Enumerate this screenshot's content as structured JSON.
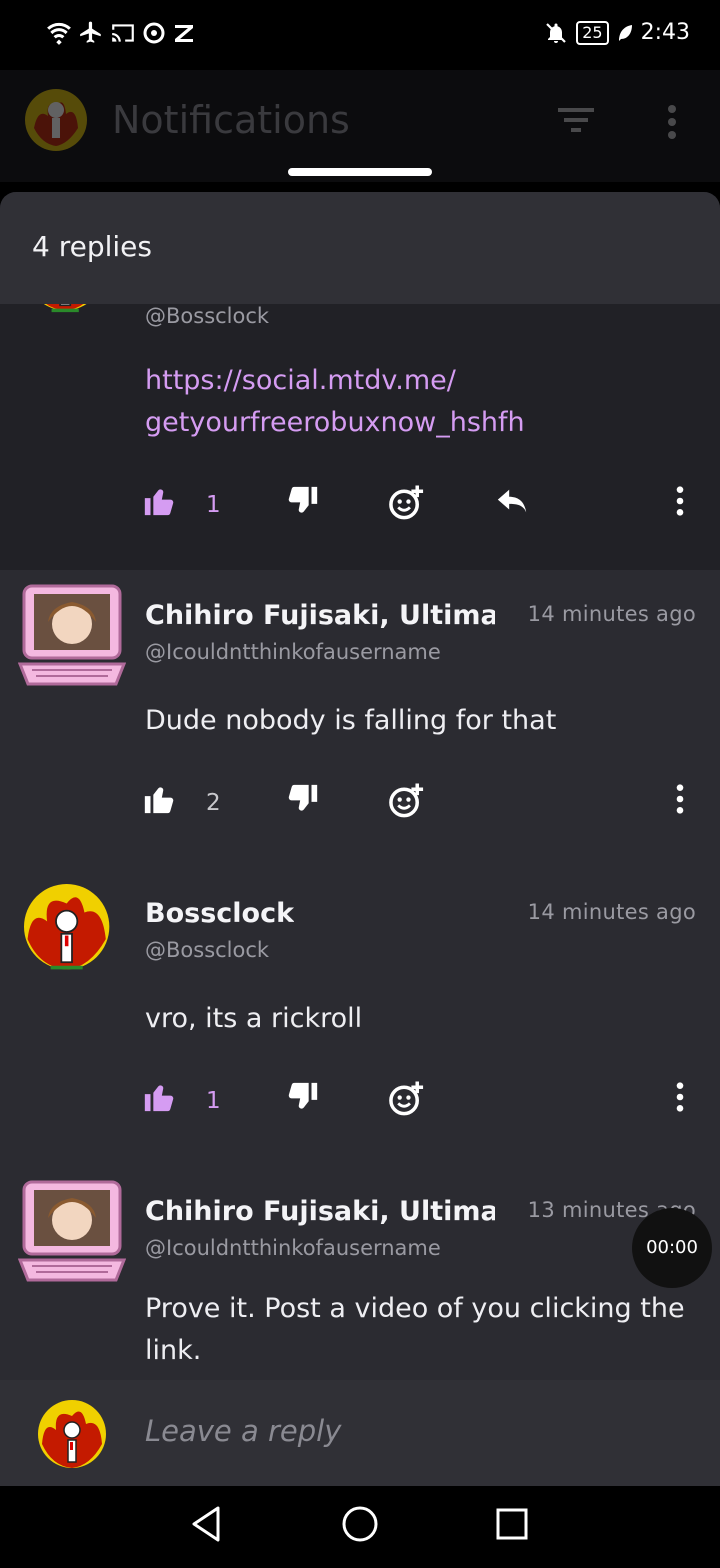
{
  "status_bar": {
    "time": "2:43",
    "battery": "25",
    "icons": [
      "wifi-icon",
      "airplane-icon",
      "cast-icon",
      "camera-icon",
      "app-icon",
      "mute-icon",
      "battery-icon",
      "leaf-icon"
    ]
  },
  "app_bar": {
    "title": "Notifications",
    "icons": [
      "filter-icon",
      "more-vertical-icon"
    ]
  },
  "sheet": {
    "title": "4 replies"
  },
  "comments": [
    {
      "name": "",
      "handle": "@Bossclock",
      "time": "",
      "body": "https://social.mtdv.me/ getyourfreerobuxnow_hshfh",
      "likes": "1",
      "liked": true,
      "avatar": "bossclock-avatar"
    },
    {
      "name": "Chihiro Fujisaki, Ultimate",
      "handle": "@Icouldntthinkofausername",
      "time": "14 minutes ago",
      "body": "Dude nobody is falling for that",
      "likes": "2",
      "liked": false,
      "avatar": "chihiro-avatar"
    },
    {
      "name": "Bossclock",
      "handle": "@Bossclock",
      "time": "14 minutes ago",
      "body": "vro, its a rickroll",
      "likes": "1",
      "liked": true,
      "avatar": "bossclock-avatar"
    },
    {
      "name": "Chihiro Fujisaki, Ultimate",
      "handle": "@Icouldntthinkofausername",
      "time": "13 minutes ago",
      "body": "Prove it. Post a video of you clicking the link.",
      "likes": "",
      "liked": false,
      "avatar": "chihiro-avatar"
    }
  ],
  "timer": "00:00",
  "reply_input": {
    "placeholder": "Leave a reply"
  },
  "colors": {
    "accent": "#d59cf2",
    "sheet_bg": "#2b2b31",
    "highlight_bg": "#212126"
  }
}
